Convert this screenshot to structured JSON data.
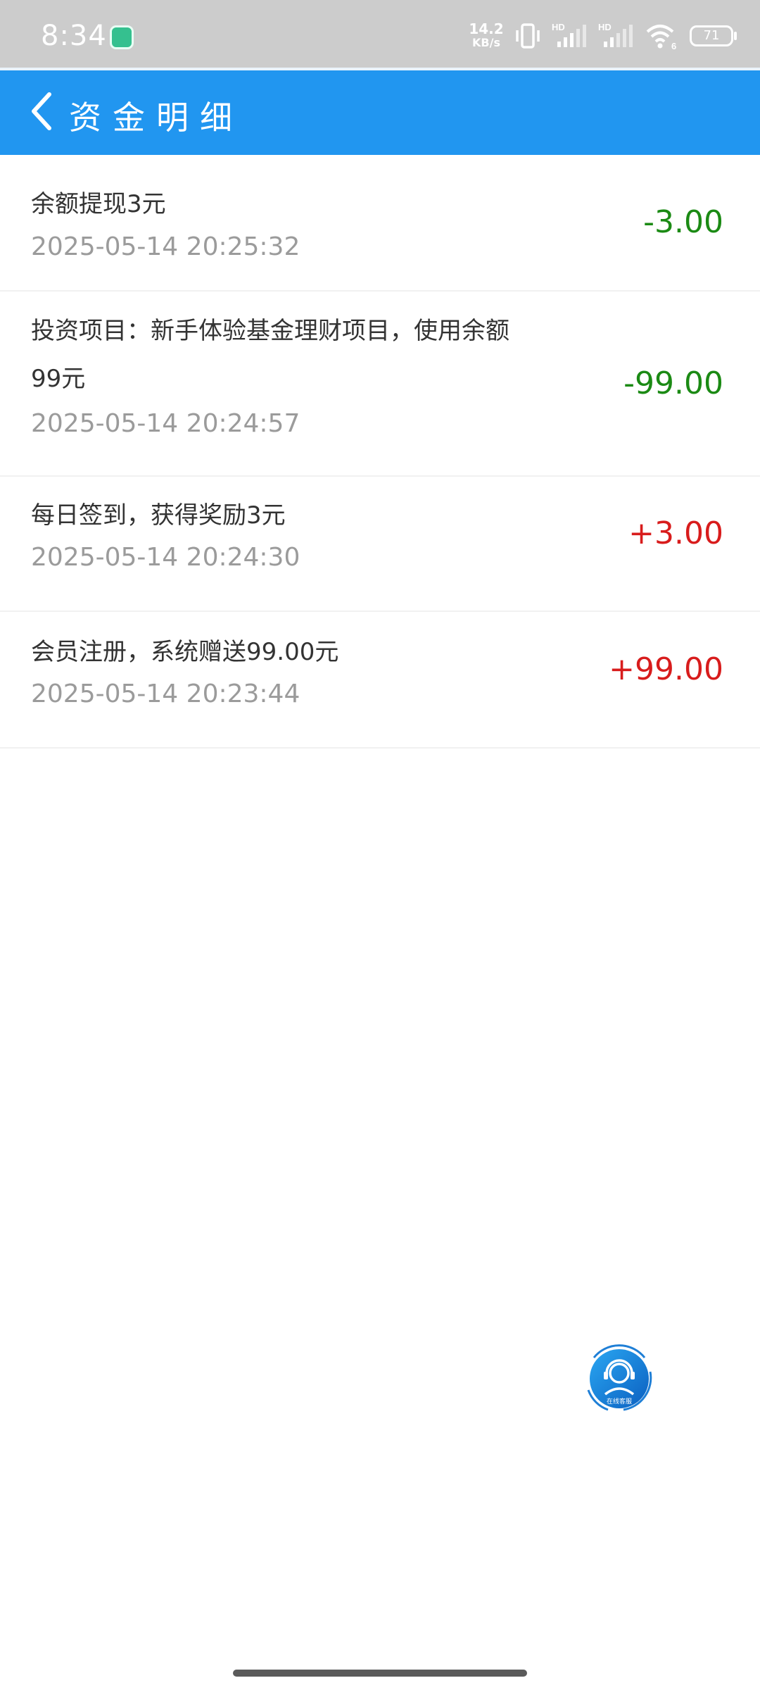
{
  "status_bar": {
    "time": "8:34",
    "net_speed_value": "14.2",
    "net_speed_unit": "KB/s",
    "network_labels": [
      "HD",
      "HD"
    ],
    "wifi_label": "6",
    "battery_level": "71",
    "icons": [
      "app-notification-icon",
      "vibrate-icon",
      "signal-icon",
      "signal-icon",
      "wifi-icon",
      "battery-icon"
    ]
  },
  "header": {
    "back_icon": "chevron-left-icon",
    "title": "资金明细",
    "background_color": "#2196f0"
  },
  "transactions": [
    {
      "title": "余额提现3元",
      "time": "2025-05-14 20:25:32",
      "amount": "-3.00"
    },
    {
      "title": "投资项目：新手体验基金理财项目，使用余额99元",
      "time": "2025-05-14 20:24:57",
      "amount": "-99.00"
    },
    {
      "title": "每日签到，获得奖励3元",
      "time": "2025-05-14 20:24:30",
      "amount": "+3.00"
    },
    {
      "title": "会员注册，系统赠送99.00元",
      "time": "2025-05-14 20:23:44",
      "amount": "+99.00"
    }
  ],
  "colors": {
    "negative_amount": "#1b8a14",
    "positive_amount": "#d81c1c",
    "time_text": "#9b9b9b"
  },
  "customer_service": {
    "icon": "customer-service-icon",
    "label": "在线客服"
  }
}
